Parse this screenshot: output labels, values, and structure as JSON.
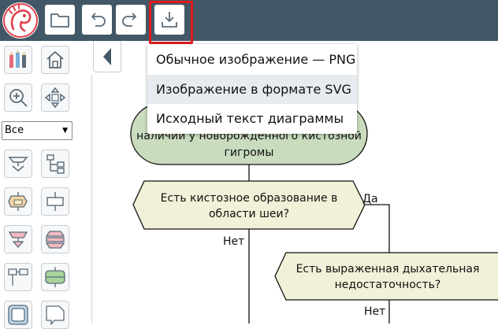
{
  "toolbar": {
    "logo_icon": "dragon-logo-icon",
    "buttons": [
      {
        "name": "open-button",
        "icon": "folder-icon"
      },
      {
        "name": "undo-button",
        "icon": "undo-icon"
      },
      {
        "name": "redo-button",
        "icon": "redo-icon"
      },
      {
        "name": "export-button",
        "icon": "download-icon"
      }
    ],
    "background_color": "#425866",
    "highlight_color": "#e11b1b"
  },
  "sidebar": {
    "filter_value": "Все",
    "tools": [
      {
        "name": "tool-pencils",
        "icon": "pencils-icon"
      },
      {
        "name": "tool-home",
        "icon": "home-icon"
      },
      {
        "name": "tool-zoom",
        "icon": "zoom-in-icon"
      },
      {
        "name": "tool-move",
        "icon": "move-arrows-icon"
      },
      {
        "name": "tool-branch",
        "icon": "branch-shape-icon"
      },
      {
        "name": "tool-tree",
        "icon": "tree-shape-icon"
      },
      {
        "name": "tool-io",
        "icon": "io-shape-icon"
      },
      {
        "name": "tool-action",
        "icon": "action-shape-icon"
      },
      {
        "name": "tool-loop-begin",
        "icon": "loop-begin-icon"
      },
      {
        "name": "tool-loop-end",
        "icon": "loop-end-icon"
      },
      {
        "name": "tool-connector",
        "icon": "connector-shape-icon"
      },
      {
        "name": "tool-parallel",
        "icon": "parallel-shape-icon"
      },
      {
        "name": "tool-frame",
        "icon": "frame-shape-icon"
      },
      {
        "name": "tool-comment",
        "icon": "comment-shape-icon"
      }
    ],
    "collapse_icon": "triangle-left-icon"
  },
  "diagram": {
    "start_lines": [
      "наличии у новорождённого кистозной",
      "гигромы"
    ],
    "question1_lines": [
      "Есть кистозное образование в",
      "области шеи?"
    ],
    "question2_lines": [
      "Есть выраженная дыхательная",
      "недостаточность?"
    ],
    "label_yes": "Да",
    "label_no_1": "Нет",
    "label_no_2": "Нет",
    "start_fill": "#c9dcbe",
    "question_fill": "#f1f0d8"
  },
  "export_menu": {
    "items": [
      {
        "label": "Обычное изображение — PNG"
      },
      {
        "label": "Изображение в формате SVG"
      },
      {
        "label": "Исходный текст диаграммы"
      }
    ],
    "hovered_index": 1
  }
}
